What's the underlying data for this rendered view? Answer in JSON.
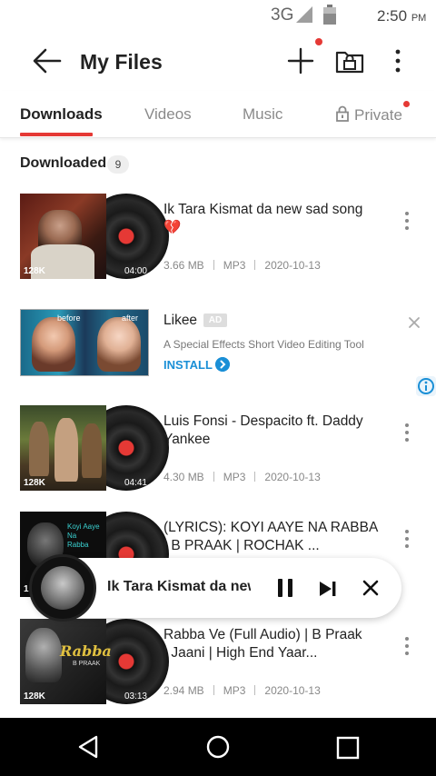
{
  "status": {
    "network": "3G",
    "time": "2:50",
    "ampm": "PM"
  },
  "header": {
    "title": "My Files"
  },
  "tabs": [
    {
      "label": "Downloads"
    },
    {
      "label": "Videos"
    },
    {
      "label": "Music"
    },
    {
      "label": "Private"
    }
  ],
  "section": {
    "title": "Downloaded",
    "count": "9"
  },
  "items": [
    {
      "title": "Ik Tara Kismat da new sad song 💔",
      "size": "3.66 MB",
      "format": "MP3",
      "date": "2020-10-13",
      "quality": "128K",
      "duration": "04:00"
    },
    {
      "title": "Luis Fonsi - Despacito ft. Daddy Yankee",
      "size": "4.30 MB",
      "format": "MP3",
      "date": "2020-10-13",
      "quality": "128K",
      "duration": "04:41"
    },
    {
      "title": "(LYRICS): KOYI AAYE NA RABBA | B PRAAK | ROCHAK ...",
      "quality": "1"
    },
    {
      "title": "Rabba Ve (Full Audio) | B Praak | Jaani | High End Yaar...",
      "size": "2.94 MB",
      "format": "MP3",
      "date": "2020-10-13",
      "quality": "128K",
      "duration": "03:13"
    }
  ],
  "ad": {
    "title": "Likee",
    "badge": "AD",
    "description": "A Special Effects Short Video Editing Tool",
    "cta": "INSTALL",
    "thumb_left": "before",
    "thumb_right": "after"
  },
  "player": {
    "title": "Ik Tara Kismat da new sad song"
  },
  "colors": {
    "accent": "#e53935",
    "link": "#1a8fd6"
  }
}
